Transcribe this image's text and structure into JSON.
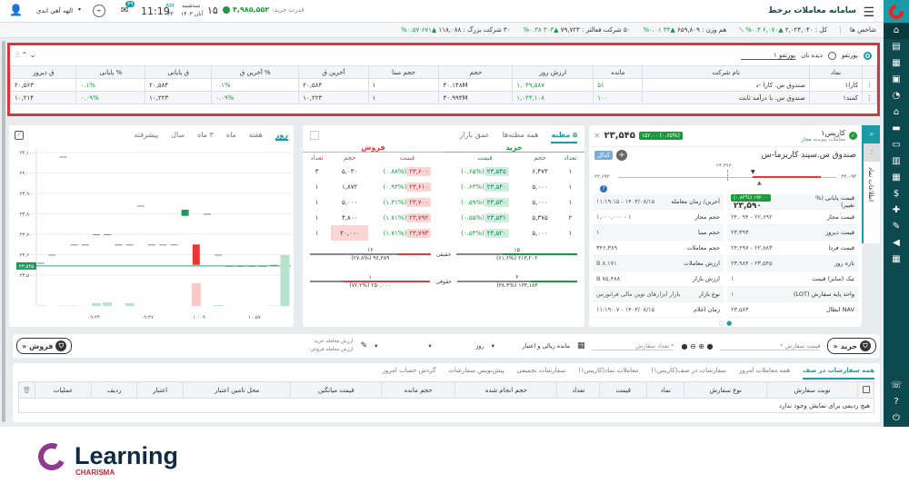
{
  "header": {
    "app_title": "سامانه معاملات برخط",
    "buying_power_label": "قدرت خرید:",
    "buying_power": "۴,۹۸۵,۵۵۲",
    "day_name": "سه‌شنبه",
    "day": "۱۵",
    "month_year": "آبان ۱۴۰۳",
    "ampm": "AM",
    "seconds": "۳۳",
    "time": "11:19",
    "mail_badge": "۴۹",
    "user_name": "الهه آهي اندي"
  },
  "indices": {
    "label": "شاخص ها",
    "items": [
      {
        "text": "کل : ۲,۰۲۴,۰۴۰",
        "change": "▲۶,۰۷۰ ۰.۳%"
      },
      {
        "text": "هم وزن : ۶۵۹,۸۰۹",
        "change": "▲۴۴ ۰.۰۱%"
      },
      {
        "text": "۵۰ شرکت فعالتر : ۷۹,۷۲۳",
        "change": "▲۳۰۳ ۰.۳۸%"
      },
      {
        "text": "۳۰ شرکت بزرگ : ۱۱۸,۰۸۸",
        "change": "▲۶۷۱ ۰.۵۷%"
      }
    ]
  },
  "portfolio": {
    "radio_portfolio": "پورتفو",
    "radio_watch": "دیده بان",
    "selected_list": "پورتفو ۱",
    "columns": [
      "نماد",
      "نام شرکت",
      "مانده",
      "ارزش روز",
      "حجم",
      "حجم مبنا",
      "آخرین ق",
      "% آخرین ق",
      "ق پایانی",
      "% پایانی",
      "ق دیروز"
    ],
    "rows": [
      [
        "کارا۱",
        "صندوق س. کارا -د",
        "۵۱",
        "۱,۰۴۹,۵۸۷",
        "۳۰.۱۴۸M",
        "۱",
        "۲۰,۵۸۴",
        "۰.۱%",
        "۲۰,۵۸۴",
        "۰.۱%",
        "۲۰,۵۶۳"
      ],
      [
        "کمند۱",
        "صندوق س. با درآمد ثابت",
        "۱۰۰",
        "۱,۰۲۳,۱۰۸",
        "۳۰.۹۹۴M",
        "۱",
        "۱۰,۲۲۳",
        "۰.۰۹%",
        "۱۰,۲۲۳",
        "۰.۰۹%",
        "۱۰,۲۱۴"
      ]
    ]
  },
  "symbol": {
    "ticker": "کاریس۱",
    "market_state": "معاملات پیوسته",
    "status": "مجاز",
    "last_price": "۲۳,۵۴۵",
    "last_change": "(۰.۶۵%) ۱۵۲.۰۰",
    "name": "صندوق س.سپند کاریزما-س",
    "codal": "کدال",
    "range_low": "۲۲,۶۹۲",
    "range_high": "۲۴,۰۹۴",
    "range_mid": "۲۳,۳۹۳",
    "side_tab": "اطلاعات نماد",
    "close_label": "قیمت پایانی (% تغییر)",
    "close_price": "۲۳,۵۹۰",
    "close_change": "(۰.۸۲%) ۱۹۲.۰۰",
    "rows": [
      [
        "قیمت پایانی (% تغییر)",
        "",
        "آخرین/ زمان معامله",
        "۱۴۰۳/۰۸/۱۵ - ۱۱:۱۹:۱۵"
      ],
      [
        "قیمت مجاز",
        "۲۲,۶۹۲ - ۲۴,۰۹۴",
        "حجم مجاز",
        "۱ - ۱,۰۰۰,۰۰۰"
      ],
      [
        "قیمت دیروز",
        "۲۳,۳۹۳",
        "حجم مبنا",
        "۱"
      ],
      [
        "قیمت فردا",
        "۲۲,۸۸۳ - ۲۴,۲۹۷",
        "حجم معاملات",
        "۳۴۶,۳۸۹"
      ],
      [
        "بازه روز",
        "۲۳,۵۴۵ - ۲۳,۹۸۴",
        "ارزش معاملات",
        "۸.۱۷۱ B"
      ],
      [
        "تیک (سایز) قیمت",
        "۱",
        "ارزش بازار",
        "۷۵,۴۸۸ B"
      ],
      [
        "واحد پایه سفارش (LOT)",
        "۱",
        "نوع بازار",
        "بازار ابزارهای نوین مالی فرابورس"
      ],
      [
        "NAV ابطال",
        "۲۳,۵۸۳",
        "زمان اعلام",
        "۱۴۰۳/۰۸/۱۵ - ۱۱:۱۹:۰۷"
      ]
    ]
  },
  "orderbook": {
    "tabs": [
      "۵ مظنه",
      "همه مظنه‌ها",
      "عمق بازار"
    ],
    "buy_label": "خرید",
    "sell_label": "فروش",
    "buy_cols": [
      "تعداد",
      "حجم",
      "قیمت"
    ],
    "sell_cols": [
      "قیمت",
      "حجم",
      "تعداد"
    ],
    "buy": [
      [
        "۱",
        "۶,۴۷۳",
        "۲۳,۵۴۵",
        "(۰.۶۵%)"
      ],
      [
        "۱",
        "۵,۰۰۰",
        "۲۳,۵۴۰",
        "(۰.۶۳%)"
      ],
      [
        "۱",
        "۵,۰۰۰",
        "۲۳,۵۳۰",
        "(۰.۵۹%)"
      ],
      [
        "۲",
        "۵,۳۷۵",
        "۲۳,۵۳۱",
        "(۰.۵۵%)"
      ],
      [
        "۱",
        "۵,۰۰۰",
        "۲۳,۵۲۰",
        "(۰.۵۴%)"
      ]
    ],
    "sell": [
      [
        "۲۳,۶۰۰",
        "(۰.۸۸%)",
        "۵,۰۳۰",
        "۳"
      ],
      [
        "۲۳,۶۱۰",
        "(۰.۹۳%)",
        "۱,۸۷۲",
        "۱"
      ],
      [
        "۲۳,۷۰۰",
        "(۱.۳۱%)",
        "۵,۰۰۰",
        "۱"
      ],
      [
        "۲۳,۷۹۲",
        "(۱.۷۱%)",
        "۴,۸۰۰",
        "۱"
      ],
      [
        "۲۳,۷۹۳",
        "(۱.۷۱%)",
        "۲۰,۰۰۰",
        "۱"
      ]
    ],
    "real": {
      "label": "حقیقی",
      "buy_count": "۱۵",
      "buy_vol": "۲۱۳,۲۰۶ (۶۱.۶%)",
      "buy_pct": 61.6,
      "sell_count": "۱۶",
      "sell_vol": "۹۶,۳۸۹ (۲۷.۸%)",
      "sell_pct": 27.8
    },
    "legal": {
      "label": "حقوقی",
      "buy_count": "۲",
      "buy_vol": "۱۳۳,۱۸۳ (۳۸.۴%)",
      "buy_pct": 38.4,
      "sell_count": "۱",
      "sell_vol": "۲۵۰,۰۰۰ (۷۲.۲%)",
      "sell_pct": 72.2
    }
  },
  "chart": {
    "tabs": [
      "روز",
      "هفته",
      "ماه",
      "۳ ماه",
      "سال",
      "پیشرفته"
    ],
    "y_ticks": [
      "۲۴,۱۰۰",
      "۲۴,۰۰۰",
      "۲۳,۹۰۰",
      "۲۳,۸۰۰",
      "۲۳,۷۰۰",
      "۲۳,۶۰۰",
      "۲۳,۵۰۰"
    ],
    "current": "۲۳,۵۴۵",
    "x_ticks": [
      "۰۹:۲۴",
      "۰۹:۴۷",
      "۱۰:۰۹",
      "۱۰:۵۷"
    ],
    "candles": [
      [
        23560,
        23560,
        0.5
      ],
      [
        23600,
        23600,
        0
      ],
      [
        24080,
        24080,
        0.5
      ],
      [
        23650,
        23650,
        0.5
      ],
      [
        23650,
        23650,
        0
      ],
      [
        23700,
        23700,
        3
      ],
      [
        23700,
        23700,
        4
      ],
      [
        23650,
        23650,
        0
      ],
      [
        23650,
        23650,
        3
      ],
      [
        23840,
        23840,
        0
      ],
      [
        23650,
        23650,
        0
      ],
      [
        23650,
        23650,
        0
      ],
      [
        23650,
        23650,
        0
      ],
      [
        23790,
        23820,
        0
      ],
      [
        23650,
        23550,
        -25
      ],
      [
        23800,
        23800,
        0
      ],
      [
        23600,
        23600,
        1
      ],
      [
        23545,
        23545,
        0
      ],
      [
        23545,
        23545,
        0
      ],
      [
        23545,
        23545,
        0
      ],
      [
        23545,
        23545,
        0
      ],
      [
        23550,
        23550,
        0.5
      ],
      [
        23545,
        23600,
        56
      ]
    ]
  },
  "order_form": {
    "buy": "خرید",
    "sell": "فروش",
    "price_placeholder": "قیمت سفارش *",
    "qty_placeholder": "* تعداد سفارش",
    "balance": "مانده ریالی و اعتبار",
    "validity": "روز",
    "buy_value": "ارزش معامله خرید:",
    "sell_value": "ارزش معامله فروش:"
  },
  "orders": {
    "tabs": [
      "همه سفارشات در صف",
      "همه معاملات امروز",
      "سفارشات در صف(کاریس۱)",
      "معاملات نماد(کاریس۱)",
      "سفارشات تجمیعی",
      "پیش‌نویس سفارشات",
      "گردش حساب امروز"
    ],
    "columns": [
      "نوبت سفارش",
      "نوع سفارش",
      "نماد",
      "قیمت",
      "تعداد",
      "حجم انجام شده",
      "حجم مانده",
      "قیمت میانگین",
      "محل تامین اعتبار",
      "اعتبار",
      "ردیف",
      "عملیات"
    ],
    "empty": "هیچ ردیفی برای نمایش وجود ندارد"
  },
  "brand": {
    "word": "Learning",
    "sub": "CHARISMA"
  },
  "colors": {
    "teal": "#1b9aa7",
    "sidebar": "#0d4a4f",
    "buy": "#1a9a3a",
    "sell": "#e03c3c",
    "highlight": "#d7363a"
  }
}
